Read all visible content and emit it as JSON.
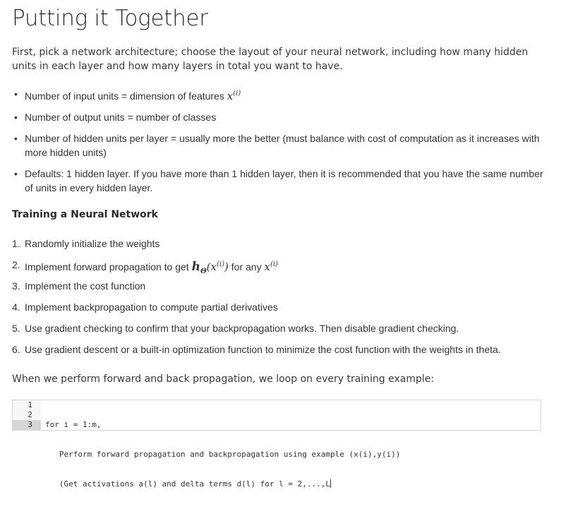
{
  "title": "Putting it Together",
  "intro": "First, pick a network architecture; choose the layout of your neural network, including how many hidden units in each layer and how many layers in total you want to have.",
  "bullets": [
    {
      "text": "Number of input units = dimension of features ",
      "math_base": "x",
      "math_sup": "(i)"
    },
    {
      "text": "Number of output units = number of classes"
    },
    {
      "text": "Number of hidden units per layer = usually more the better (must balance with cost of computation as it increases with more hidden units)"
    },
    {
      "text": "Defaults: 1 hidden layer. If you have more than 1 hidden layer, then it is recommended that you have the same number of units in every hidden layer."
    }
  ],
  "subheading": "Training a Neural Network",
  "steps": [
    {
      "num": "1.",
      "text": "Randomly initialize the weights"
    },
    {
      "num": "2.",
      "text_before": "Implement forward propagation to get ",
      "math_h": "h",
      "math_theta": "Θ",
      "math_arg_base": "x",
      "math_arg_sup": "(i)",
      "text_mid": " for any ",
      "math_base": "x",
      "math_sup": "(i)"
    },
    {
      "num": "3.",
      "text": "Implement the cost function"
    },
    {
      "num": "4.",
      "text": "Implement backpropagation to compute partial derivatives"
    },
    {
      "num": "5.",
      "text": "Use gradient checking to confirm that your backpropagation works. Then disable gradient checking."
    },
    {
      "num": "6.",
      "text": "Use gradient descent or a built-in optimization function to minimize the cost function with the weights in theta."
    }
  ],
  "outro": "When we perform forward and back propagation, we loop on every training example:",
  "code": {
    "line_numbers": [
      "1",
      "2",
      "3"
    ],
    "lines": [
      "for i = 1:m,",
      "   Perform forward propagation and backpropagation using example (x(i),y(i))",
      "   (Get activations a(l) and delta terms d(l) for l = 2,...,L"
    ],
    "active_line": 3
  }
}
